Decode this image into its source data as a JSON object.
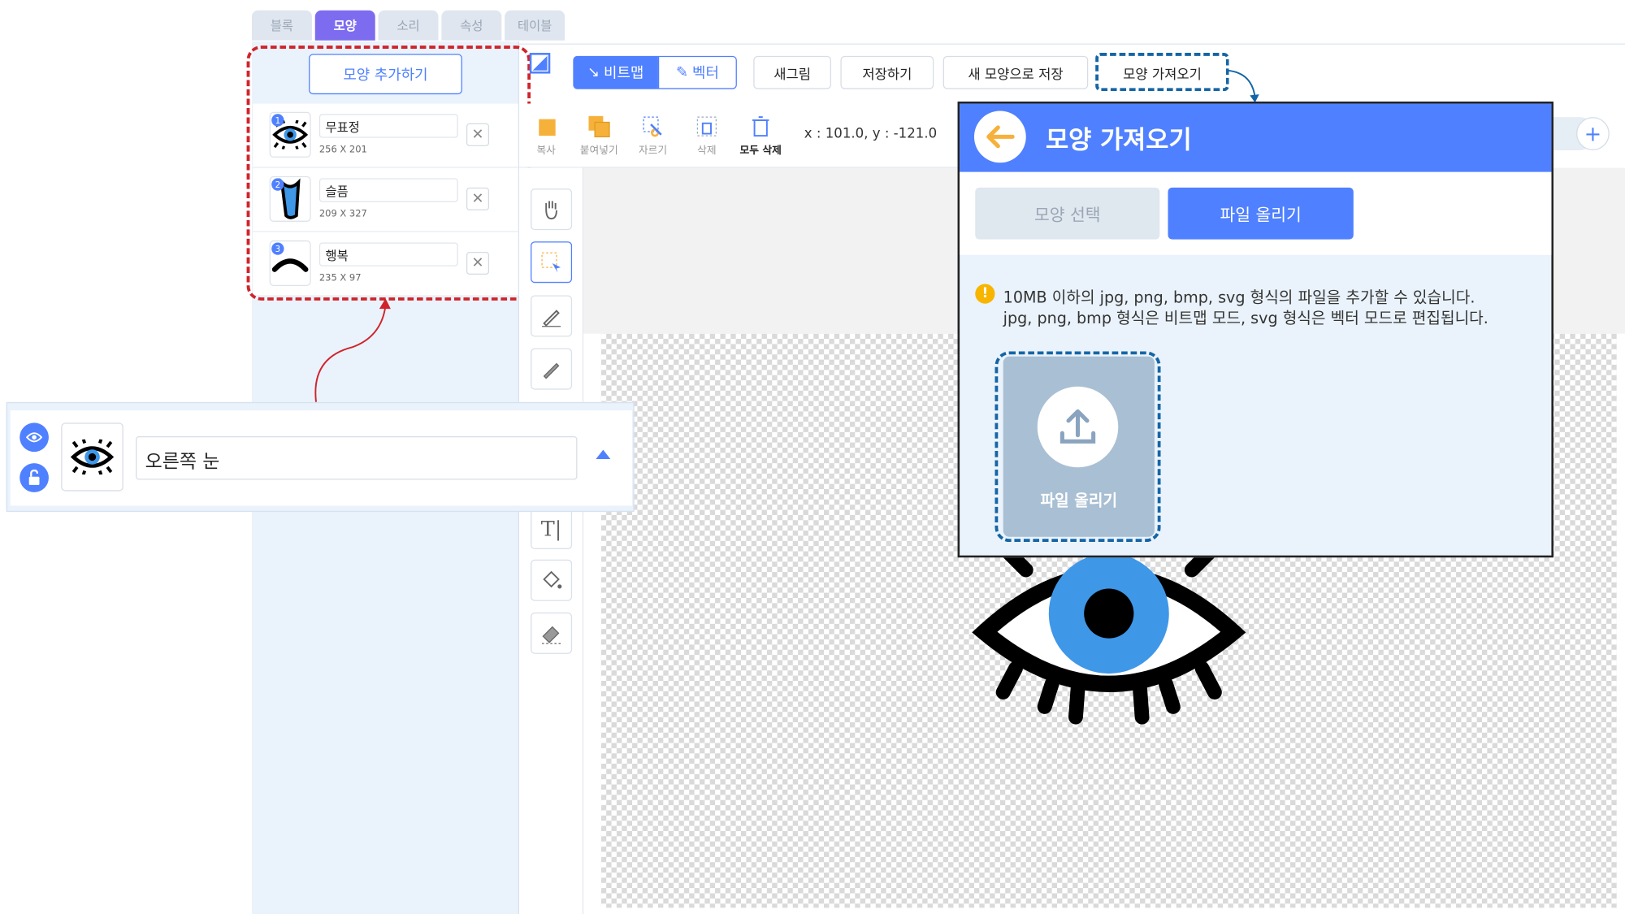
{
  "tabs": [
    "블록",
    "모양",
    "소리",
    "속성",
    "테이블"
  ],
  "add_costume_label": "모양 추가하기",
  "costumes": [
    {
      "num": "1",
      "name": "무표정",
      "size": "256 X 201"
    },
    {
      "num": "2",
      "name": "슬픔",
      "size": "209 X 327"
    },
    {
      "num": "3",
      "name": "행복",
      "size": "235 X 97"
    }
  ],
  "toolbar": {
    "bitmap": "비트맵",
    "vector": "벡터",
    "new_drawing": "새그림",
    "save": "저장하기",
    "save_new": "새 모양으로 저장",
    "import": "모양 가져오기"
  },
  "tools": {
    "copy": "복사",
    "paste": "붙여넣기",
    "cut": "자르기",
    "delete": "삭제",
    "delete_all": "모두 삭제"
  },
  "coords": "x : 101.0, y : -121.0",
  "layer": {
    "name": "오른쪽 눈"
  },
  "modal": {
    "title": "모양 가져오기",
    "tab_select": "모양 선택",
    "tab_upload": "파일 올리기",
    "info_line1": "10MB 이하의 jpg, png, bmp, svg 형식의 파일을 추가할 수 있습니다.",
    "info_line2": "jpg, png, bmp 형식은 비트맵 모드, svg 형식은 벡터 모드로 편집됩니다.",
    "upload_label": "파일 올리기",
    "warn_symbol": "!"
  },
  "colors": {
    "accent": "#4f80ff",
    "tab_active": "#7d6cf0",
    "highlight_red": "#d0232b",
    "highlight_blue": "#1565a6"
  }
}
